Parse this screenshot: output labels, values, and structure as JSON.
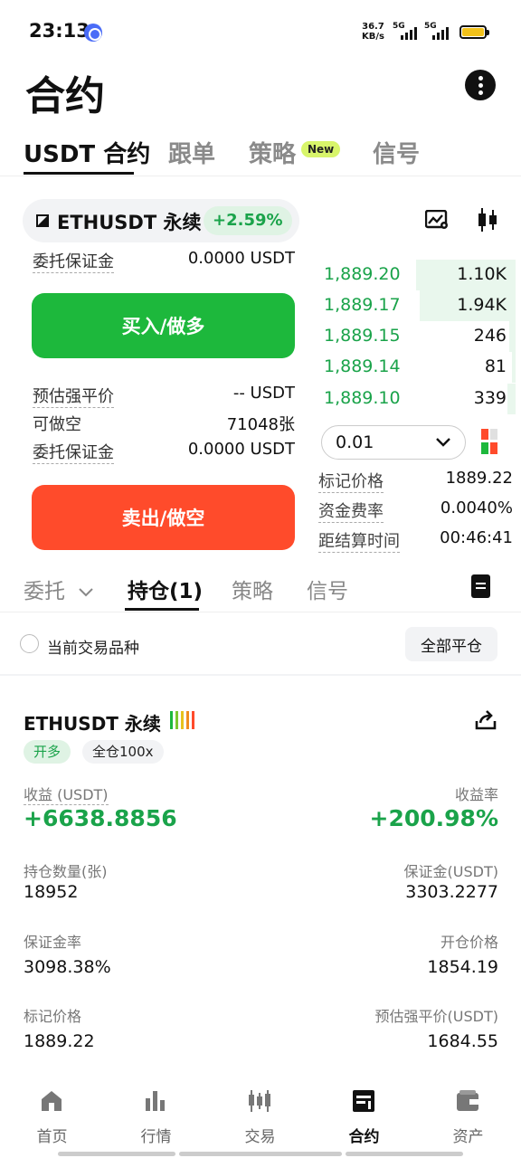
{
  "status": {
    "time": "23:13",
    "net_speed_value": "36.7",
    "net_speed_unit": "KB/s",
    "signal1": "5G",
    "signal2": "5G"
  },
  "header": {
    "title": "合约"
  },
  "top_tabs": [
    {
      "label": "USDT 合约",
      "active": true
    },
    {
      "label": "跟单",
      "active": false
    },
    {
      "label": "策略",
      "active": false,
      "badge": "New"
    },
    {
      "label": "信号",
      "active": false
    }
  ],
  "symbol": {
    "name": "ETHUSDT  永续",
    "change": "+2.59%"
  },
  "order_form": {
    "top_label": "委托保证金",
    "top_value": "0.0000 USDT",
    "buy_label": "买入/做多",
    "liq_label": "预估强平价",
    "liq_value": "-- USDT",
    "short_label": "可做空",
    "short_value": "71048张",
    "margin_label": "委托保证金",
    "margin_value": "0.0000 USDT",
    "sell_label": "卖出/做空"
  },
  "order_book": {
    "rows": [
      {
        "price": "1,889.20",
        "size": "1.10K",
        "depth": 0.5
      },
      {
        "price": "1,889.17",
        "size": "1.94K",
        "depth": 0.48
      },
      {
        "price": "1,889.15",
        "size": "246",
        "depth": 0.03
      },
      {
        "price": "1,889.14",
        "size": "81",
        "depth": 0.02
      },
      {
        "price": "1,889.10",
        "size": "339",
        "depth": 0.04
      }
    ],
    "step": "0.01"
  },
  "market_info": {
    "mark_label": "标记价格",
    "mark_value": "1889.22",
    "funding_label": "资金费率",
    "funding_value": "0.0040%",
    "settle_label": "距结算时间",
    "settle_value": "00:46:41"
  },
  "section_tabs": {
    "orders": "委托",
    "positions": "持仓(1)",
    "strategy": "策略",
    "signal": "信号"
  },
  "filter": {
    "current_symbol_label": "当前交易品种",
    "close_all": "全部平仓"
  },
  "position": {
    "symbol": "ETHUSDT 永续",
    "side_tag": "开多",
    "margin_tag": "全仓100x",
    "pnl_label": "收益 (USDT)",
    "pnl_value": "+6638.8856",
    "roe_label": "收益率",
    "roe_value": "+200.98%",
    "qty_label": "持仓数量(张)",
    "qty_value": "18952",
    "margin_label": "保证金(USDT)",
    "margin_value": "3303.2277",
    "margin_ratio_label": "保证金率",
    "margin_ratio_value": "3098.38%",
    "entry_label": "开仓价格",
    "entry_value": "1854.19",
    "mark_label": "标记价格",
    "mark_value": "1889.22",
    "liq_label": "预估强平价(USDT)",
    "liq_value": "1684.55"
  },
  "bottom_nav": [
    {
      "label": "首页",
      "icon": "home-icon",
      "active": false
    },
    {
      "label": "行情",
      "icon": "market-bars-icon",
      "active": false
    },
    {
      "label": "交易",
      "icon": "trade-candles-icon",
      "active": false
    },
    {
      "label": "合约",
      "icon": "contract-icon",
      "active": true
    },
    {
      "label": "资产",
      "icon": "wallet-icon",
      "active": false
    }
  ],
  "colors": {
    "buy_green": "#1db83c",
    "sell_red": "#ff4b2b",
    "profit_green": "#1aa34a",
    "new_badge": "#d8f56b"
  }
}
